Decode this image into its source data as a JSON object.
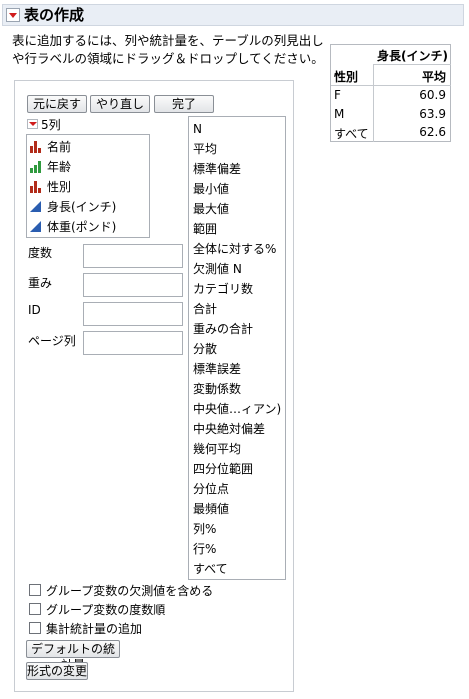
{
  "header": {
    "title": "表の作成"
  },
  "instructions": [
    "表に追加するには、列や統計量を、テーブルの列見出し",
    "や行ラベルの領域にドラッグ＆ドロップしてください。"
  ],
  "toolbar": {
    "undo_label": "元に戻す",
    "redo_label": "やり直し",
    "done_label": "完了"
  },
  "columns": {
    "count_label": "5列",
    "items": [
      {
        "label": "名前",
        "icon": "nominal-bar-icon",
        "color": "#b22b1a"
      },
      {
        "label": "年齢",
        "icon": "ordinal-bar-icon",
        "color": "#2f9a3e"
      },
      {
        "label": "性別",
        "icon": "nominal-bar-icon",
        "color": "#b22b1a"
      },
      {
        "label": "身長(インチ)",
        "icon": "continuous-triangle-icon",
        "color": "#2a5db0"
      },
      {
        "label": "体重(ポンド)",
        "icon": "continuous-triangle-icon",
        "color": "#2a5db0"
      }
    ]
  },
  "roles": {
    "freq": "度数",
    "weight": "重み",
    "id": "ID",
    "page": "ページ列"
  },
  "statistics": [
    "N",
    "平均",
    "標準偏差",
    "最小値",
    "最大値",
    "範囲",
    "全体に対する%",
    "欠測値 N",
    "カテゴリ数",
    "合計",
    "重みの合計",
    "分散",
    "標準誤差",
    "変動係数",
    "中央値…ィアン)",
    "中央絶対偏差",
    "幾何平均",
    "四分位範囲",
    "分位点",
    "最頻値",
    "列%",
    "行%",
    "すべて"
  ],
  "options": {
    "include_missing": "グループ変数の欠測値を含める",
    "order_by_freq": "グループ変数の度数順",
    "add_summary": "集計統計量の追加"
  },
  "bottom_buttons": {
    "default_stats": "デフォルトの統計量",
    "change_format": "形式の変更"
  },
  "preview": {
    "column_header": "身長(インチ)",
    "row_header": "性別",
    "stat_header": "平均",
    "rows": [
      {
        "label": "F",
        "value": "60.9"
      },
      {
        "label": "M",
        "value": "63.9"
      },
      {
        "label": "すべて",
        "value": "62.6"
      }
    ]
  }
}
